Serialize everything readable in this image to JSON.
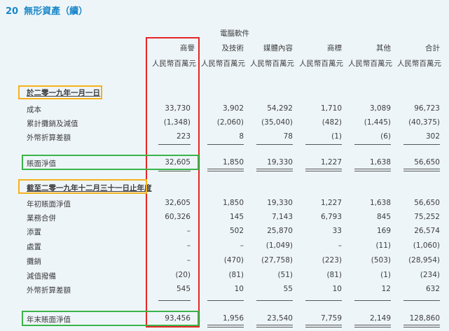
{
  "title": {
    "number": "20",
    "text": "無形資產（續）"
  },
  "headers": {
    "goodwill": [
      "商譽",
      "人民幣百萬元"
    ],
    "software": [
      "電腦軟件",
      "及技術",
      "人民幣百萬元"
    ],
    "media": [
      "媒體內容",
      "人民幣百萬元"
    ],
    "trademark": [
      "商標",
      "人民幣百萬元"
    ],
    "other": [
      "其他",
      "人民幣百萬元"
    ],
    "total": [
      "合計",
      "人民幣百萬元"
    ]
  },
  "rows": [
    {
      "label": "於二零一九年一月一日",
      "values": [
        "",
        "",
        "",
        "",
        "",
        ""
      ]
    },
    {
      "label": "成本",
      "values": [
        "33,730",
        "3,902",
        "54,292",
        "1,710",
        "3,089",
        "96,723"
      ]
    },
    {
      "label": "累計攤銷及減值",
      "values": [
        "(1,348)",
        "(2,060)",
        "(35,040)",
        "(482)",
        "(1,445)",
        "(40,375)"
      ]
    },
    {
      "label": "外幣折算差額",
      "values": [
        "223",
        "8",
        "78",
        "(1)",
        "(6)",
        "302"
      ]
    },
    {
      "label": "賬面淨值",
      "values": [
        "32,605",
        "1,850",
        "19,330",
        "1,227",
        "1,638",
        "56,650"
      ]
    },
    {
      "label": "截至二零一九年十二月三十一日止年度",
      "values": [
        "",
        "",
        "",
        "",
        "",
        ""
      ]
    },
    {
      "label": "年初賬面淨值",
      "values": [
        "32,605",
        "1,850",
        "19,330",
        "1,227",
        "1,638",
        "56,650"
      ]
    },
    {
      "label": "業務合併",
      "values": [
        "60,326",
        "145",
        "7,143",
        "6,793",
        "845",
        "75,252"
      ]
    },
    {
      "label": "添置",
      "values": [
        "–",
        "502",
        "25,870",
        "33",
        "169",
        "26,574"
      ]
    },
    {
      "label": "處置",
      "values": [
        "–",
        "–",
        "(1,049)",
        "–",
        "(11)",
        "(1,060)"
      ]
    },
    {
      "label": "攤銷",
      "values": [
        "–",
        "(470)",
        "(27,758)",
        "(223)",
        "(503)",
        "(28,954)"
      ]
    },
    {
      "label": "減值撥備",
      "values": [
        "(20)",
        "(81)",
        "(51)",
        "(81)",
        "(1)",
        "(234)"
      ]
    },
    {
      "label": "外幣折算差額",
      "values": [
        "545",
        "10",
        "55",
        "10",
        "12",
        "632"
      ]
    },
    {
      "label": "年末賬面淨值",
      "values": [
        "93,456",
        "1,956",
        "23,540",
        "7,759",
        "2,149",
        "128,860"
      ]
    }
  ],
  "colors": {
    "title": "#1a88c9",
    "red_box": "#e52525",
    "yellow_box": "#f5b21c",
    "green_box": "#3ab449"
  }
}
